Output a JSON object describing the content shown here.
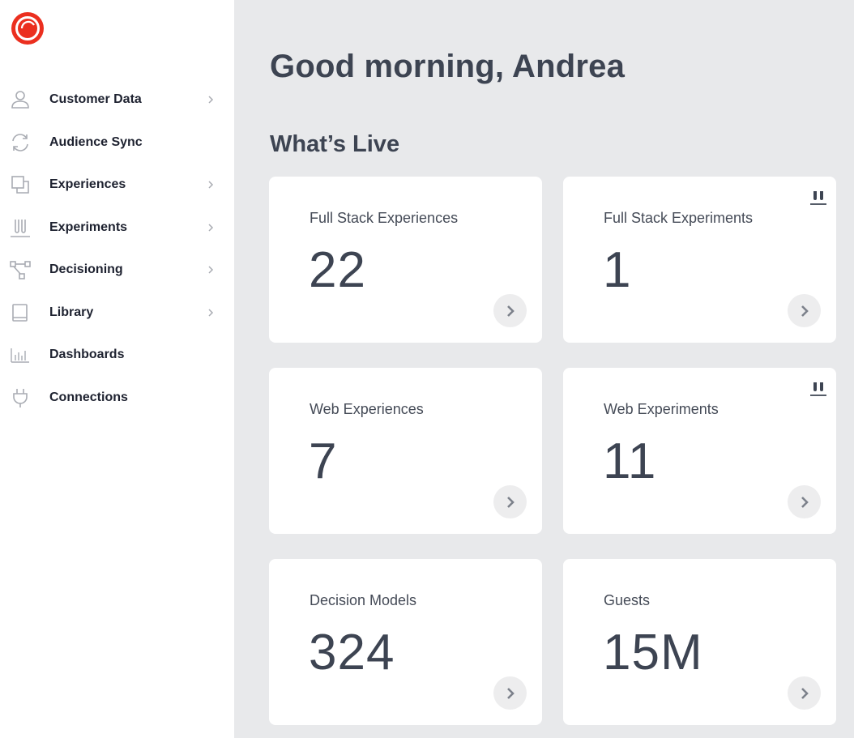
{
  "sidebar": {
    "logo_icon": "sitecore-logo-icon",
    "items": [
      {
        "label": "Customer Data",
        "icon": "user-icon",
        "has_submenu": true
      },
      {
        "label": "Audience Sync",
        "icon": "sync-icon",
        "has_submenu": false
      },
      {
        "label": "Experiences",
        "icon": "layers-icon",
        "has_submenu": true
      },
      {
        "label": "Experiments",
        "icon": "test-tubes-icon",
        "has_submenu": true
      },
      {
        "label": "Decisioning",
        "icon": "flow-icon",
        "has_submenu": true
      },
      {
        "label": "Library",
        "icon": "book-icon",
        "has_submenu": true
      },
      {
        "label": "Dashboards",
        "icon": "bar-chart-icon",
        "has_submenu": false
      },
      {
        "label": "Connections",
        "icon": "plug-icon",
        "has_submenu": false
      }
    ]
  },
  "main": {
    "greeting": "Good morning, Andrea",
    "section_title": "What’s Live",
    "cards": [
      {
        "label": "Full Stack Experiences",
        "value": "22",
        "badge": false
      },
      {
        "label": "Full Stack Experiments",
        "value": "1",
        "badge": true
      },
      {
        "label": "Web Experiences",
        "value": "7",
        "badge": false
      },
      {
        "label": "Web Experiments",
        "value": "11",
        "badge": true
      },
      {
        "label": "Decision Models",
        "value": "324",
        "badge": false
      },
      {
        "label": "Guests",
        "value": "15M",
        "badge": false
      }
    ]
  },
  "colors": {
    "brand": "#eb2f1f",
    "text_dark": "#1e2230",
    "heading": "#3d4452",
    "icon_gray": "#a9acb3",
    "background": "#e8e9eb"
  }
}
